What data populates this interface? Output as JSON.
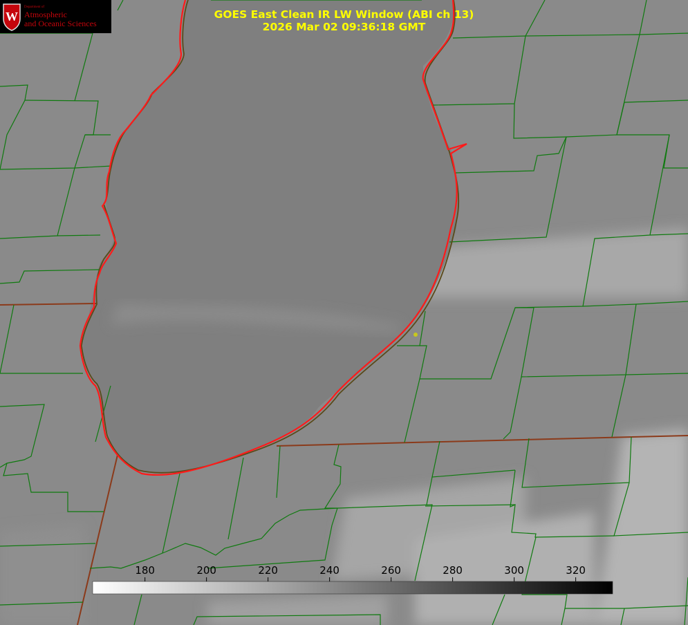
{
  "logo": {
    "department": "Department of",
    "line1": "Atmospheric",
    "line2": "and Oceanic Sciences",
    "crest_letter": "W"
  },
  "title": {
    "line1": "GOES East Clean IR LW Window (ABI ch 13)",
    "line2": "2026 Mar 02 09:36:18 GMT"
  },
  "colorbar": {
    "ticks": [
      "180",
      "200",
      "220",
      "240",
      "260",
      "280",
      "300",
      "320"
    ],
    "tick_values": [
      180,
      200,
      220,
      240,
      260,
      280,
      300,
      320
    ],
    "range": [
      163,
      332
    ],
    "gradient": "white-to-black"
  },
  "colors": {
    "county_lines": "#0f7a0f",
    "lake_outline": "#ff1a1a",
    "state_line": "#8b3a1a",
    "marker": "#c8c81e",
    "title_text": "#ffff00",
    "logo_text": "#c5050c"
  }
}
